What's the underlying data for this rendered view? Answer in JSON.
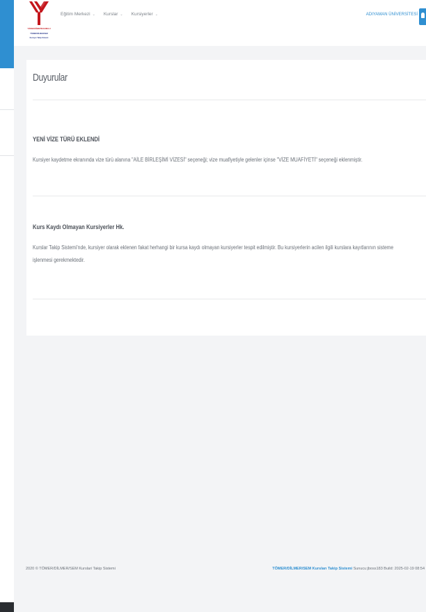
{
  "header": {
    "logo_lines": [
      "YÜKSEKÖĞRETİM KURULU",
      "TÖMER/DİLMER/SEM",
      "Kursiyer Takip Sistemi"
    ],
    "nav": [
      {
        "label": "Eğitim Merkezi"
      },
      {
        "label": "Kurslar"
      },
      {
        "label": "Kursiyerler"
      }
    ],
    "university": "ADIYAMAN ÜNİVERSİTESİ",
    "colors": {
      "accent": "#2f8fd1",
      "logo_red": "#c4161c"
    }
  },
  "main": {
    "title": "Duyurular",
    "announcements": [
      {
        "title": "YENİ VİZE TÜRÜ EKLENDİ",
        "body": "Kursiyer kaydetme ekranında vize türü alanına \"AİLE BİRLEŞİMİ VİZESİ\" seçeneği; vize muafiyetiyle gelenler içinse \"VİZE MUAFİYETİ\" seçeneği eklenmiştir."
      },
      {
        "title": "Kurs Kaydı Olmayan Kursiyerler Hk.",
        "body": "Kurslar Takip Sistemi'nde, kursiyer olarak eklenen fakat herhangi bir kursa kaydı olmayan kursiyerler tespit edilmiştir. Bu kursiyerlerin acilen ilgili kurslara kayıtlarının sisteme işlenmesi gerekmektedir."
      }
    ]
  },
  "footer": {
    "copyright": "2020 © TÖMER/DİLMER/SEM Kurslari Takip Sistemi",
    "brand": "TÖMER/DİLMER/SEM Kursları Takip Sistemi",
    "build": "Sunucu:jboss183  Build: 2025-02-19 08:54"
  }
}
